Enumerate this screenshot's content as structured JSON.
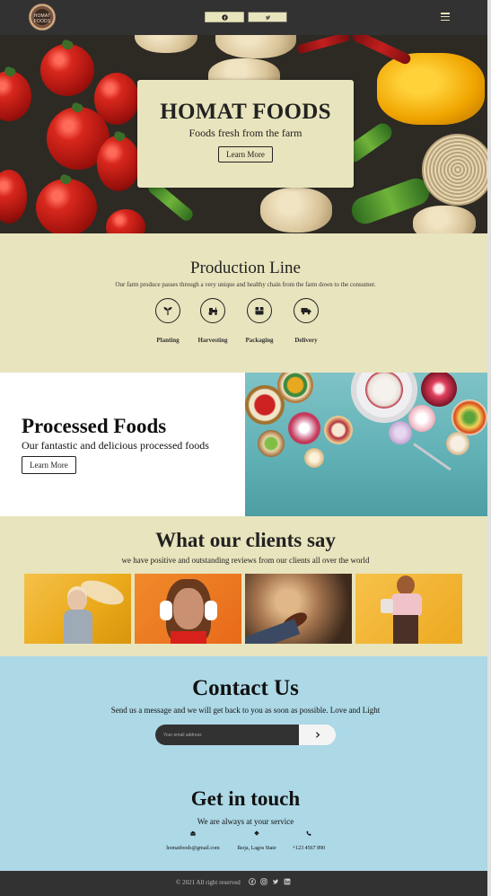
{
  "nav": {
    "logo_text": "HOMAT FOODS",
    "facebook_icon": "facebook-icon",
    "twitter_icon": "twitter-icon",
    "menu_icon": "hamburger-menu-icon"
  },
  "hero": {
    "title": "HOMAT FOODS",
    "subtitle": "Foods fresh from the farm",
    "button_label": "Learn More"
  },
  "production": {
    "title": "Production Line",
    "description": "Our farm produce passes through a very unique and healthy chain from the farm down to the consumer.",
    "steps": [
      {
        "label": "Planting",
        "icon": "seedling-icon"
      },
      {
        "label": "Harvesting",
        "icon": "tractor-icon"
      },
      {
        "label": "Packaging",
        "icon": "box-icon"
      },
      {
        "label": "Delivery",
        "icon": "truck-icon"
      }
    ]
  },
  "processed": {
    "title": "Processed Foods",
    "subtitle": "Our fantastic and delicious processed foods",
    "button_label": "Learn More"
  },
  "clients": {
    "title": "What our clients say",
    "subtitle": "we have positive and outstanding reviews from our clients all over the world"
  },
  "contact": {
    "title": "Contact Us",
    "description": "Send us a message and we will get back to you as soon as possible. Love and Light",
    "email_placeholder": "Your email address",
    "submit_icon": "chevron-right-icon"
  },
  "touch": {
    "title": "Get in touch",
    "subtitle": "We are always at your service",
    "email": "homatfoods@gmail.com",
    "location": "Ikoja, Lagos State",
    "phone": "+123 4567 890"
  },
  "footer": {
    "copyright": "© 2021 All right reserved",
    "icons": [
      "facebook-icon",
      "instagram-icon",
      "twitter-icon",
      "linkedin-icon"
    ]
  },
  "colors": {
    "dark": "#333232",
    "cream": "#e8e4bd",
    "light_blue": "#add8e6"
  }
}
